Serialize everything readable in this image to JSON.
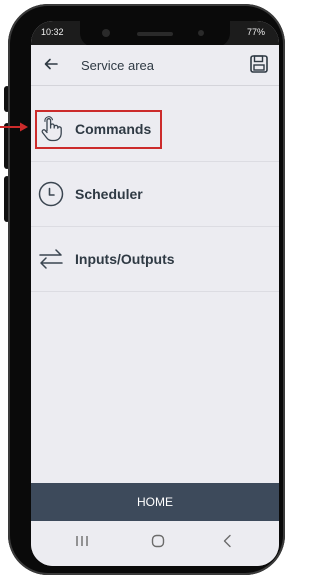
{
  "status_bar": {
    "time": "10:32",
    "battery": "77%"
  },
  "header": {
    "title": "Service area",
    "back_icon": "arrow-left-icon",
    "save_icon": "floppy-disk-icon"
  },
  "menu": {
    "items": [
      {
        "label": "Commands",
        "icon": "hand-pointer-icon",
        "highlighted": true
      },
      {
        "label": "Scheduler",
        "icon": "clock-icon"
      },
      {
        "label": "Inputs/Outputs",
        "icon": "arrows-exchange-icon"
      }
    ]
  },
  "bottom_bar": {
    "label": "HOME"
  },
  "nav_bar": {
    "buttons": [
      "recent-apps-icon",
      "home-circle-icon",
      "back-chevron-icon"
    ]
  },
  "colors": {
    "screen_bg": "#ececf1",
    "home_bar": "#3d4a5b",
    "highlight": "#cc2b2b",
    "text": "#2f3a44"
  }
}
